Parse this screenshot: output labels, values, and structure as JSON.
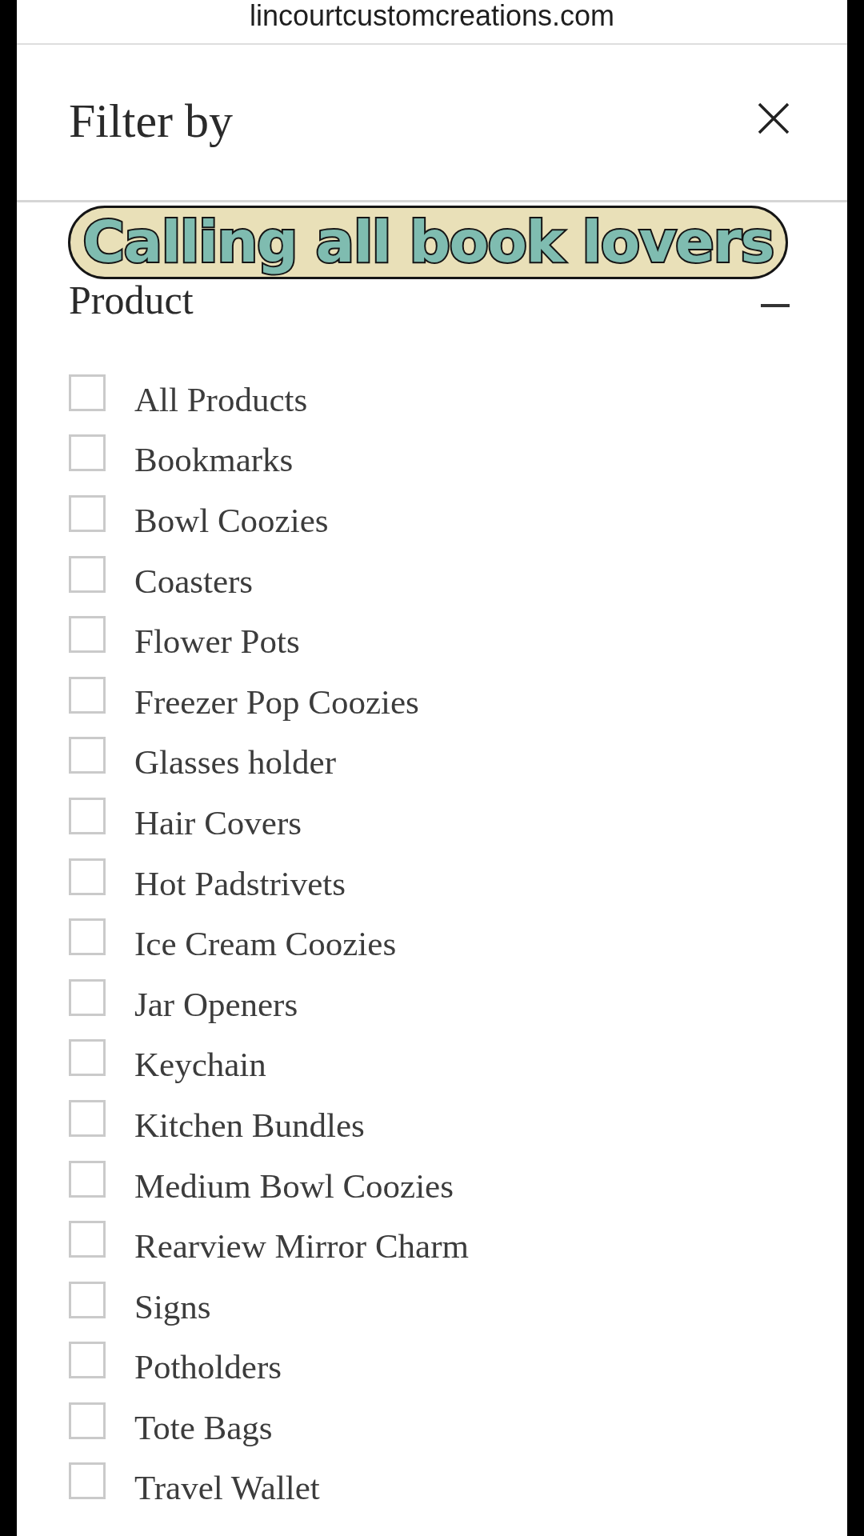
{
  "browser": {
    "url": "lincourtcustomcreations.com"
  },
  "panel": {
    "title": "Filter by"
  },
  "caption": {
    "text": "Calling all book lovers"
  },
  "section": {
    "title": "Product",
    "expanded": true
  },
  "options": [
    {
      "label": "All Products",
      "checked": false
    },
    {
      "label": "Bookmarks",
      "checked": false
    },
    {
      "label": "Bowl Coozies",
      "checked": false
    },
    {
      "label": "Coasters",
      "checked": false
    },
    {
      "label": "Flower Pots",
      "checked": false
    },
    {
      "label": "Freezer Pop Coozies",
      "checked": false
    },
    {
      "label": "Glasses holder",
      "checked": false
    },
    {
      "label": "Hair Covers",
      "checked": false
    },
    {
      "label": "Hot Padstrivets",
      "checked": false
    },
    {
      "label": "Ice Cream Coozies",
      "checked": false
    },
    {
      "label": "Jar Openers",
      "checked": false
    },
    {
      "label": "Keychain",
      "checked": false
    },
    {
      "label": "Kitchen Bundles",
      "checked": false
    },
    {
      "label": "Medium Bowl Coozies",
      "checked": false
    },
    {
      "label": "Rearview Mirror Charm",
      "checked": false
    },
    {
      "label": "Signs",
      "checked": false
    },
    {
      "label": "Potholders",
      "checked": false
    },
    {
      "label": "Tote Bags",
      "checked": false
    },
    {
      "label": "Travel Wallet",
      "checked": false
    }
  ]
}
